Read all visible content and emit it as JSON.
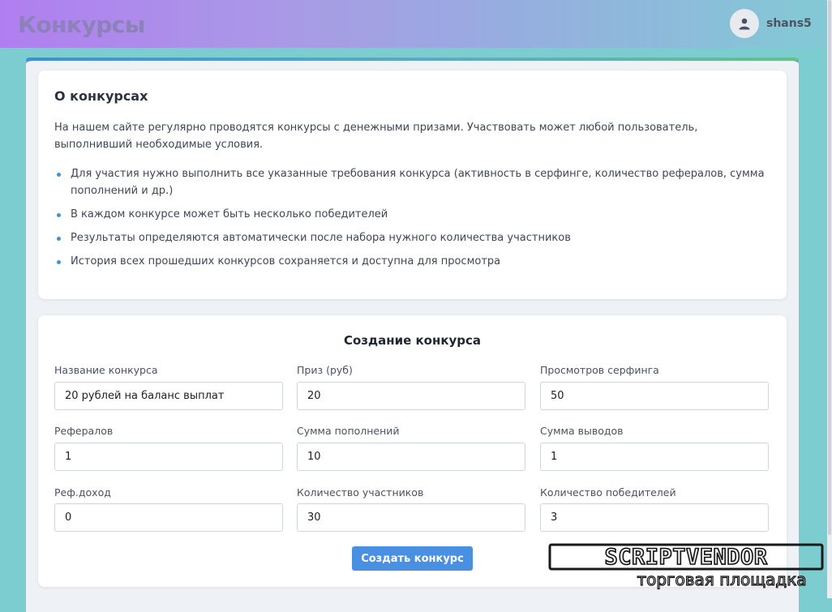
{
  "header": {
    "title": "Конкурсы",
    "username": "shans5",
    "colors": {
      "gradient_start": "#b07ef0",
      "gradient_end": "#83c9d6"
    }
  },
  "about": {
    "title": "О конкурсах",
    "intro": "На нашем сайте регулярно проводятся конкурсы с денежными призами. Участвовать может любой пользователь, выполнивший необходимые условия.",
    "items": [
      "Для участия нужно выполнить все указанные требования конкурса (активность в серфинге, количество рефералов, сумма пополнений и др.)",
      "В каждом конкурсе может быть несколько победителей",
      "Результаты определяются автоматически после набора нужного количества участников",
      "История всех прошедших конкурсов сохраняется и доступна для просмотра"
    ]
  },
  "form": {
    "title": "Создание конкурса",
    "fields": [
      {
        "label": "Название конкурса",
        "value": "20 рублей на баланс выплат"
      },
      {
        "label": "Приз (руб)",
        "value": "20"
      },
      {
        "label": "Просмотров серфинга",
        "value": "50"
      },
      {
        "label": "Рефералов",
        "value": "1"
      },
      {
        "label": "Сумма пополнений",
        "value": "10"
      },
      {
        "label": "Сумма выводов",
        "value": "1"
      },
      {
        "label": "Реф.доход",
        "value": "0"
      },
      {
        "label": "Количество участников",
        "value": "30"
      },
      {
        "label": "Количество победителей",
        "value": "3"
      }
    ],
    "submit_label": "Создать конкурс",
    "accent_color": "#4a90e2"
  },
  "watermark": {
    "brand": "SCRIPTVENDOR",
    "tagline": "торговая площадка"
  }
}
